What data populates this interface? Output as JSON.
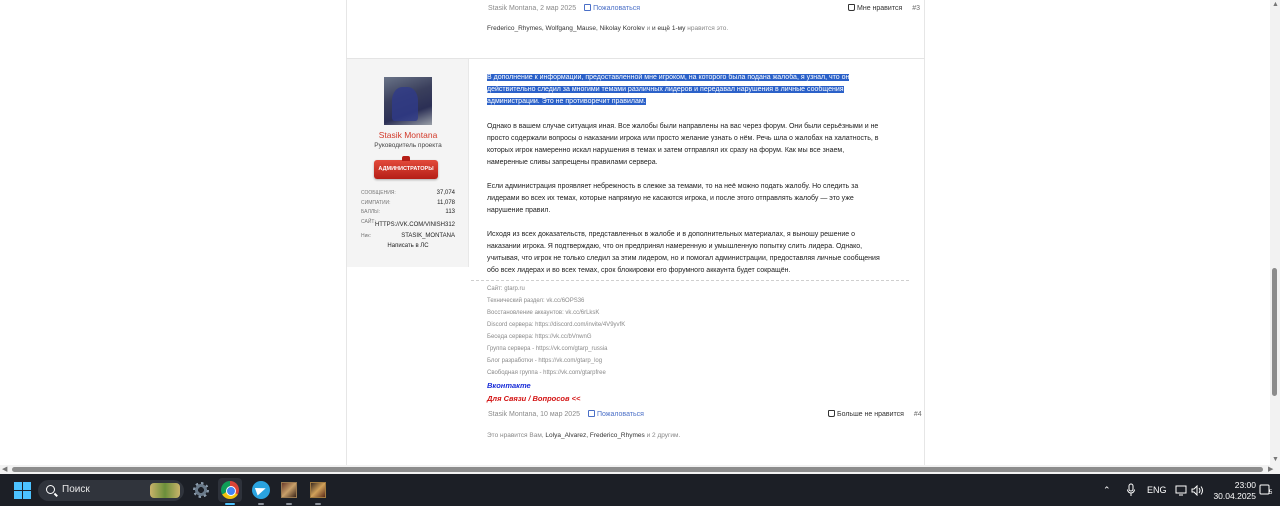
{
  "prev_post": {
    "author": "Stasik Montana",
    "date": "2 мар 2025",
    "report_label": "Пожаловаться",
    "like_label": "Мне нравится",
    "post_number": "#3",
    "likers_names": "Frederico_Rhymes, Wolfgang_Mause, Nikolay Korolev",
    "likers_more": "и ещё 1-му",
    "likers_suffix": "нравится это."
  },
  "user": {
    "name": "Stasik Montana",
    "title": "Руководитель проекта",
    "badge": "АДМИНИСТРАТОРЫ",
    "stats": [
      {
        "key": "Сообщения:",
        "value": "37,074"
      },
      {
        "key": "Симпатии:",
        "value": "11,078"
      },
      {
        "key": "Баллы:",
        "value": "113"
      },
      {
        "key": "Сайт:",
        "value": ""
      }
    ],
    "site_value": "HTTPS://VK.COM/VINISH312",
    "nick_key": "Ник:",
    "nick_value": "STASIK_MONTANA",
    "write_pm": "Написать в ЛС"
  },
  "post": {
    "highlighted_lines": [
      "В дополнение к информации, предоставленной мне игроком, на которого была подана жалоба, я узнал, что он",
      "действительно следил за многими темами различных лидеров и передавал нарушения в личные сообщения",
      "администрации. Это не противоречит правилам."
    ],
    "p2_lines": [
      "Однако в вашем случае ситуация иная. Все жалобы были направлены на вас через форум. Они были серьёзными и не",
      "просто содержали вопросы о наказании игрока или просто желание узнать о нём. Речь шла о жалобах на халатность, в",
      "которых игрок намеренно искал нарушения в темах и затем отправлял их сразу на форум. Как мы все знаем,",
      "намеренные сливы запрещены правилами сервера."
    ],
    "p3_lines": [
      "Если администрация проявляет небрежность в слежке за темами, то на неё можно подать жалобу. Но следить за",
      "лидерами во всех их темах, которые напрямую не касаются игрока, и после этого отправлять жалобу — это уже",
      "нарушение правил."
    ],
    "p4_lines": [
      "Исходя из всех доказательств, представленных в жалобе и в дополнительных материалах, я выношу решение о",
      "наказании игрока. Я подтверждаю, что он предпринял намеренную и умышленную попытку слить лидера. Однако,",
      "учитывая, что игрок не только следил за этим лидером, но и помогал администрации, предоставляя личные сообщения",
      "обо всех лидерах и во всех темах, срок блокировки его форумного аккаунта будет сокращён."
    ]
  },
  "signature": {
    "lines": [
      {
        "label": "Сайт:",
        "link": "gtarp.ru"
      },
      {
        "label": "Технический раздел:",
        "link": "vk.cc/6OPS36"
      },
      {
        "label": "Восстановление аккаунтов:",
        "link": "vk.cc/6rLksK"
      },
      {
        "label": "Discord сервера:",
        "link": "https://discord.com/invite/4V9yvfK"
      },
      {
        "label": "Беседа сервера:",
        "link": "https://vk.cc/bVnwnG"
      },
      {
        "label": "Группа сервера -",
        "link": "https://vk.com/gtarp_russia"
      },
      {
        "label": "Блог разработки -",
        "link": "https://vk.com/gtarp_log"
      },
      {
        "label": "Свободная группа -",
        "link": "https://vk.com/gtarpfree"
      }
    ],
    "vk": "Вконтакте",
    "contact": "Для Связи / Вопросов <<"
  },
  "cur_post": {
    "author": "Stasik Montana",
    "date": "10 мар 2025",
    "report_label": "Пожаловаться",
    "like_label": "Больше не нравится",
    "post_number": "#4",
    "likers_prefix": "Это нравится Вам,",
    "likers_names": "Lolya_Alvarez, Frederico_Rhymes",
    "likers_suffix": "и 2 другим."
  },
  "taskbar": {
    "search_label": "Поиск",
    "language": "ENG",
    "time": "23:00",
    "date": "30.04.2025",
    "tray_chevron": "⌃",
    "notification_count": "5"
  },
  "colors": {
    "accent": "#2b61c9",
    "username": "#d23a2a",
    "badge": "#c8281f",
    "vk_link": "#1a2ed8",
    "contact_link": "#d31111"
  }
}
